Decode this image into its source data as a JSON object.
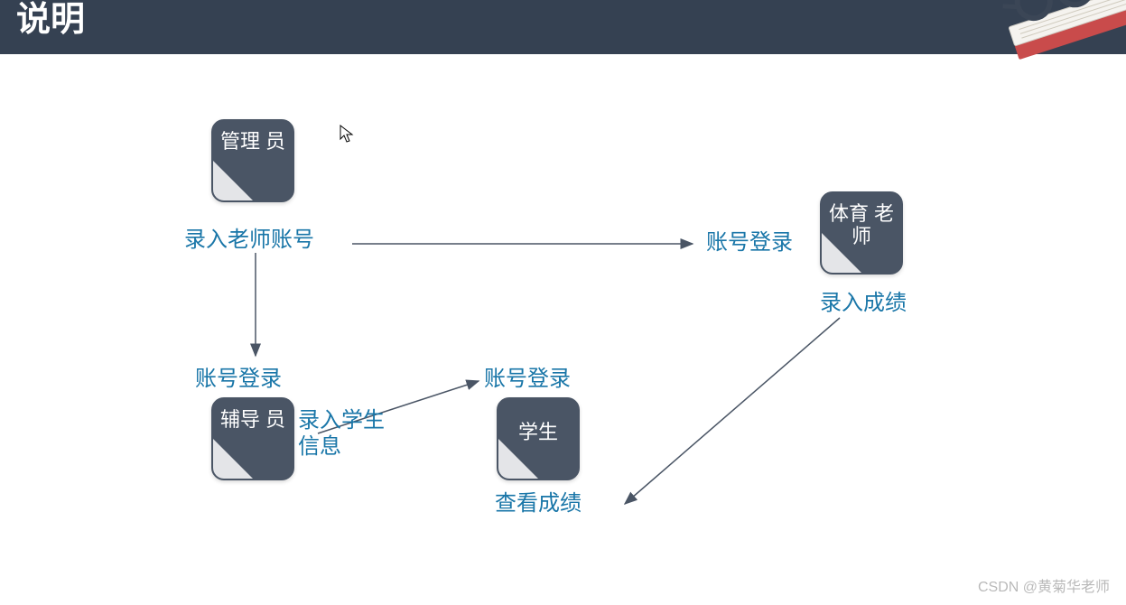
{
  "header": {
    "title": "说明"
  },
  "nodes": {
    "admin": {
      "label": "管理\n员"
    },
    "pe": {
      "label": "体育\n老师"
    },
    "tutor": {
      "label": "辅导\n员"
    },
    "student": {
      "label": "学生"
    }
  },
  "labels": {
    "enterTeacherAccount": "录入老师账号",
    "accountLogin1": "账号登录",
    "enterScore": "录入成绩",
    "accountLogin2": "账号登录",
    "accountLogin3": "账号登录",
    "enterStudentInfo": "录入学生\n信息",
    "viewScore": "查看成绩"
  },
  "watermark": "CSDN @黄菊华老师"
}
